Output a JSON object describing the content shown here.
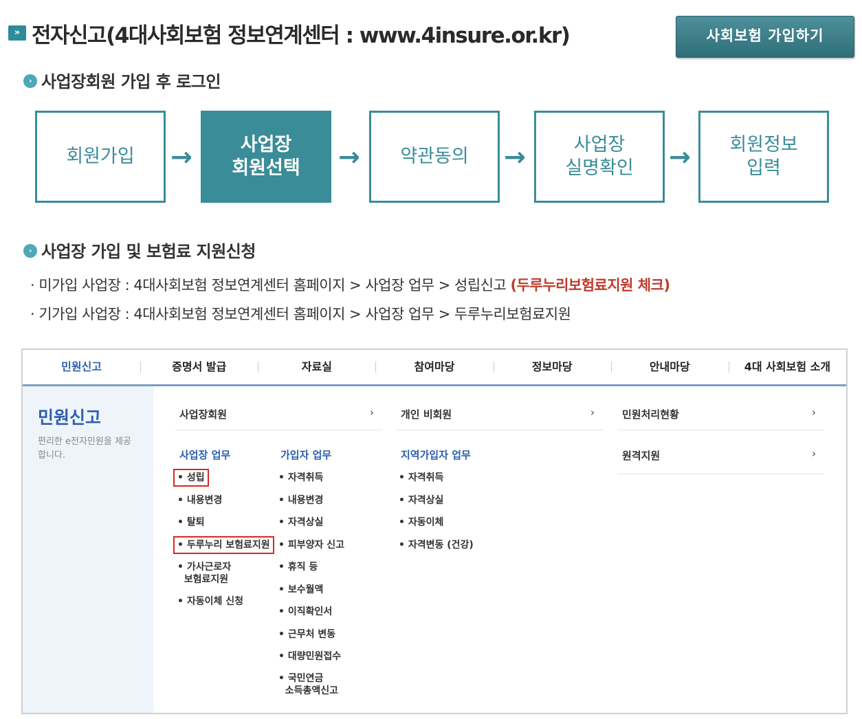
{
  "header": {
    "icon_glyph": "»",
    "title": "전자신고(4대사회보험 정보연계센터 : www.4insure.or.kr)",
    "join_button": "사회보험 가입하기"
  },
  "section1": {
    "title": "사업장회원 가입 후 로그인",
    "steps": [
      {
        "label": "회원가입",
        "active": false
      },
      {
        "label": "사업장\n회원선택",
        "active": true
      },
      {
        "label": "약관동의",
        "active": false
      },
      {
        "label": "사업장\n실명확인",
        "active": false
      },
      {
        "label": "회원정보\n입력",
        "active": false
      }
    ],
    "arrow_glyph": "→"
  },
  "section2": {
    "title": "사업장 가입 및 보험료 지원신청",
    "line1": "미가입 사업장 : 4대사회보험 정보연계센터 홈페이지 > 사업장 업무 > 성립신고 ",
    "line1_highlight": "(두루누리보험료지원 체크)",
    "line2": "기가입 사업장 : 4대사회보험 정보연계센터 홈페이지 > 사업장 업무 > 두루누리보험료지원"
  },
  "nav": {
    "tabs": [
      "민원신고",
      "증명서 발급",
      "자료실",
      "참여마당",
      "정보마당",
      "안내마당",
      "4대 사회보험 소개"
    ],
    "active_tab": 0,
    "sidebar_title": "민원신고",
    "sidebar_desc": "편리한 e전자민원을 제공합니다.",
    "rows": [
      "사업장회원",
      "개인 비회원",
      "민원처리현황",
      "원격지원"
    ],
    "chevron": "›",
    "columns": {
      "business": {
        "title": "사업장 업무",
        "items": [
          "• 성립",
          "• 내용변경",
          "• 탈퇴",
          "• 두루누리 보험료지원",
          "• 가사근로자\n  보험료지원",
          "• 자동이체 신청"
        ]
      },
      "subscriber": {
        "title": "가입자 업무",
        "items": [
          "• 자격취득",
          "• 내용변경",
          "• 자격상실",
          "• 피부양자 신고",
          "• 휴직 등",
          "• 보수월액",
          "• 이직확인서",
          "• 근무처 변동",
          "• 대량민원접수",
          "• 국민연금\n  소득총액신고"
        ]
      },
      "regional": {
        "title": "지역가입자 업무",
        "items": [
          "• 자격취득",
          "• 자격상실",
          "• 자동이체",
          "• 자격변동 (건강)"
        ]
      }
    }
  },
  "colors": {
    "teal": "#3a8c98",
    "blue": "#2a5fb0",
    "red": "#d62828"
  }
}
